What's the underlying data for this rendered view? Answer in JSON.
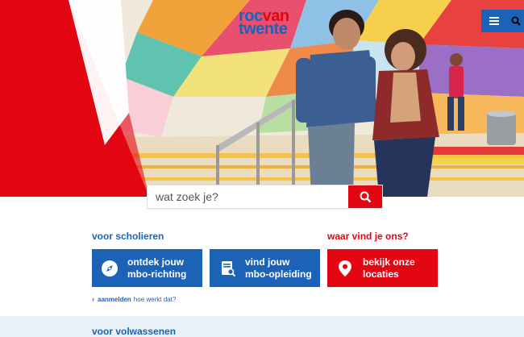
{
  "logo": {
    "part1": "roc",
    "part2": "van",
    "part3": "twente"
  },
  "topbar": {
    "menu_icon": "hamburger-icon",
    "search_icon": "search-icon"
  },
  "search": {
    "placeholder": "wat zoek je?"
  },
  "scholieren": {
    "heading": "voor scholieren",
    "cards": [
      {
        "label": "ontdek jouw\nmbo-richting",
        "icon": "compass-icon"
      },
      {
        "label": "vind jouw\nmbo-opleiding",
        "icon": "book-search-icon"
      }
    ],
    "signup_link": "aanmelden",
    "signup_text": "hoe werkt dat?"
  },
  "locations": {
    "heading": "waar vind je ons?",
    "card": {
      "label": "bekijk onze\nlocaties",
      "icon": "location-pin-icon"
    }
  },
  "volwassenen": {
    "heading": "voor volwassenen"
  },
  "colors": {
    "brand_blue": "#1c63b7",
    "brand_red": "#e30613",
    "band_bg": "#e8f0f8"
  }
}
